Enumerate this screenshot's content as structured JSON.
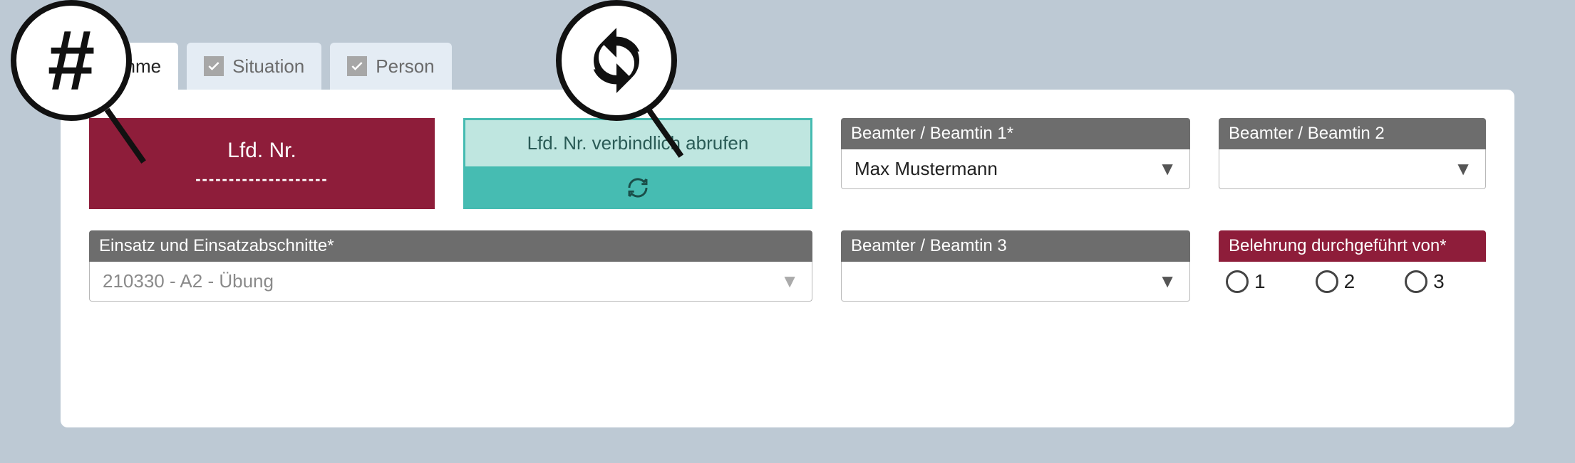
{
  "tabs": {
    "uebernahme": "bernahme",
    "situation": "Situation",
    "person": "Person"
  },
  "lfd": {
    "title": "Lfd. Nr.",
    "placeholder": "--------------------"
  },
  "fetch": {
    "label": "Lfd. Nr. verbindlich abrufen"
  },
  "officers": {
    "label1": "Beamter / Beamtin 1*",
    "value1": "Max Mustermann",
    "label2": "Beamter / Beamtin 2",
    "value2": "",
    "label3": "Beamter / Beamtin 3",
    "value3": ""
  },
  "assignment": {
    "label": "Einsatz und Einsatzabschnitte*",
    "value": "210330 - A2 - Übung"
  },
  "instruction": {
    "label": "Belehrung durchgeführt von*",
    "options": {
      "a": "1",
      "b": "2",
      "c": "3"
    }
  }
}
